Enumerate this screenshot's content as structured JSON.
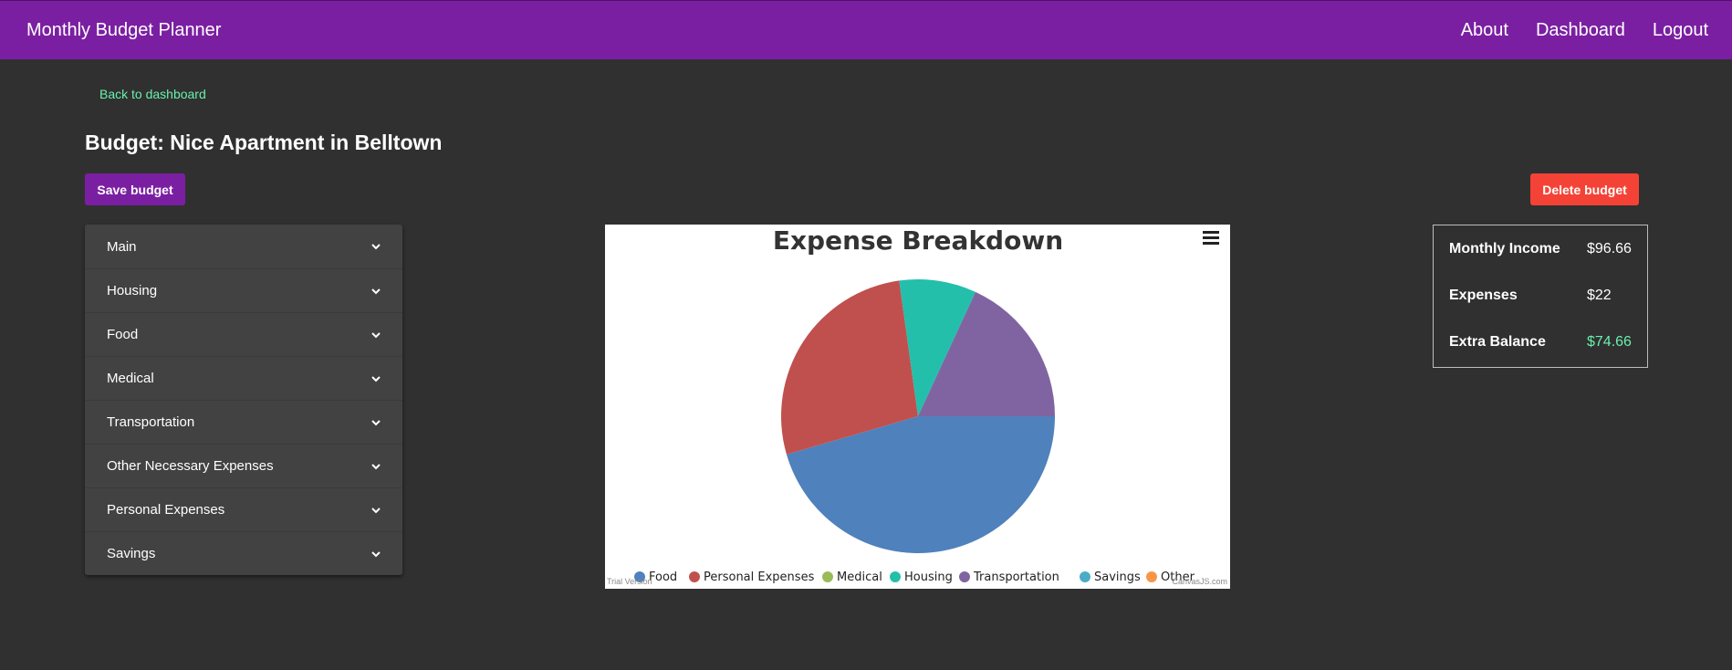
{
  "navbar": {
    "brand": "Monthly Budget Planner",
    "links": [
      "About",
      "Dashboard",
      "Logout"
    ]
  },
  "back_link": "Back to dashboard",
  "page_title": "Budget: Nice Apartment in Belltown",
  "buttons": {
    "save": "Save budget",
    "delete": "Delete budget"
  },
  "accordion": [
    "Main",
    "Housing",
    "Food",
    "Medical",
    "Transportation",
    "Other Necessary Expenses",
    "Personal Expenses",
    "Savings"
  ],
  "summary": {
    "income_label": "Monthly Income",
    "income_value": "$96.66",
    "expenses_label": "Expenses",
    "expenses_value": "$22",
    "balance_label": "Extra Balance",
    "balance_value": "$74.66"
  },
  "watermark": {
    "left": "Trial Version",
    "right": "CanvasJS.com"
  },
  "colors": {
    "navbar": "#7b1fa2",
    "delete": "#f44336",
    "accent_green": "#69f0ae",
    "background": "#303030"
  },
  "chart_data": {
    "type": "pie",
    "title": "Expense Breakdown",
    "categories": [
      "Food",
      "Personal Expenses",
      "Medical",
      "Housing",
      "Transportation",
      "Savings",
      "Other"
    ],
    "values": [
      45.5,
      27.3,
      0,
      9.1,
      18.1,
      0,
      0
    ],
    "colors": [
      "#4f81bc",
      "#c0504e",
      "#9bbb58",
      "#23bfaa",
      "#8064a1",
      "#4aacc5",
      "#f79647"
    ],
    "legend_position": "bottom"
  }
}
